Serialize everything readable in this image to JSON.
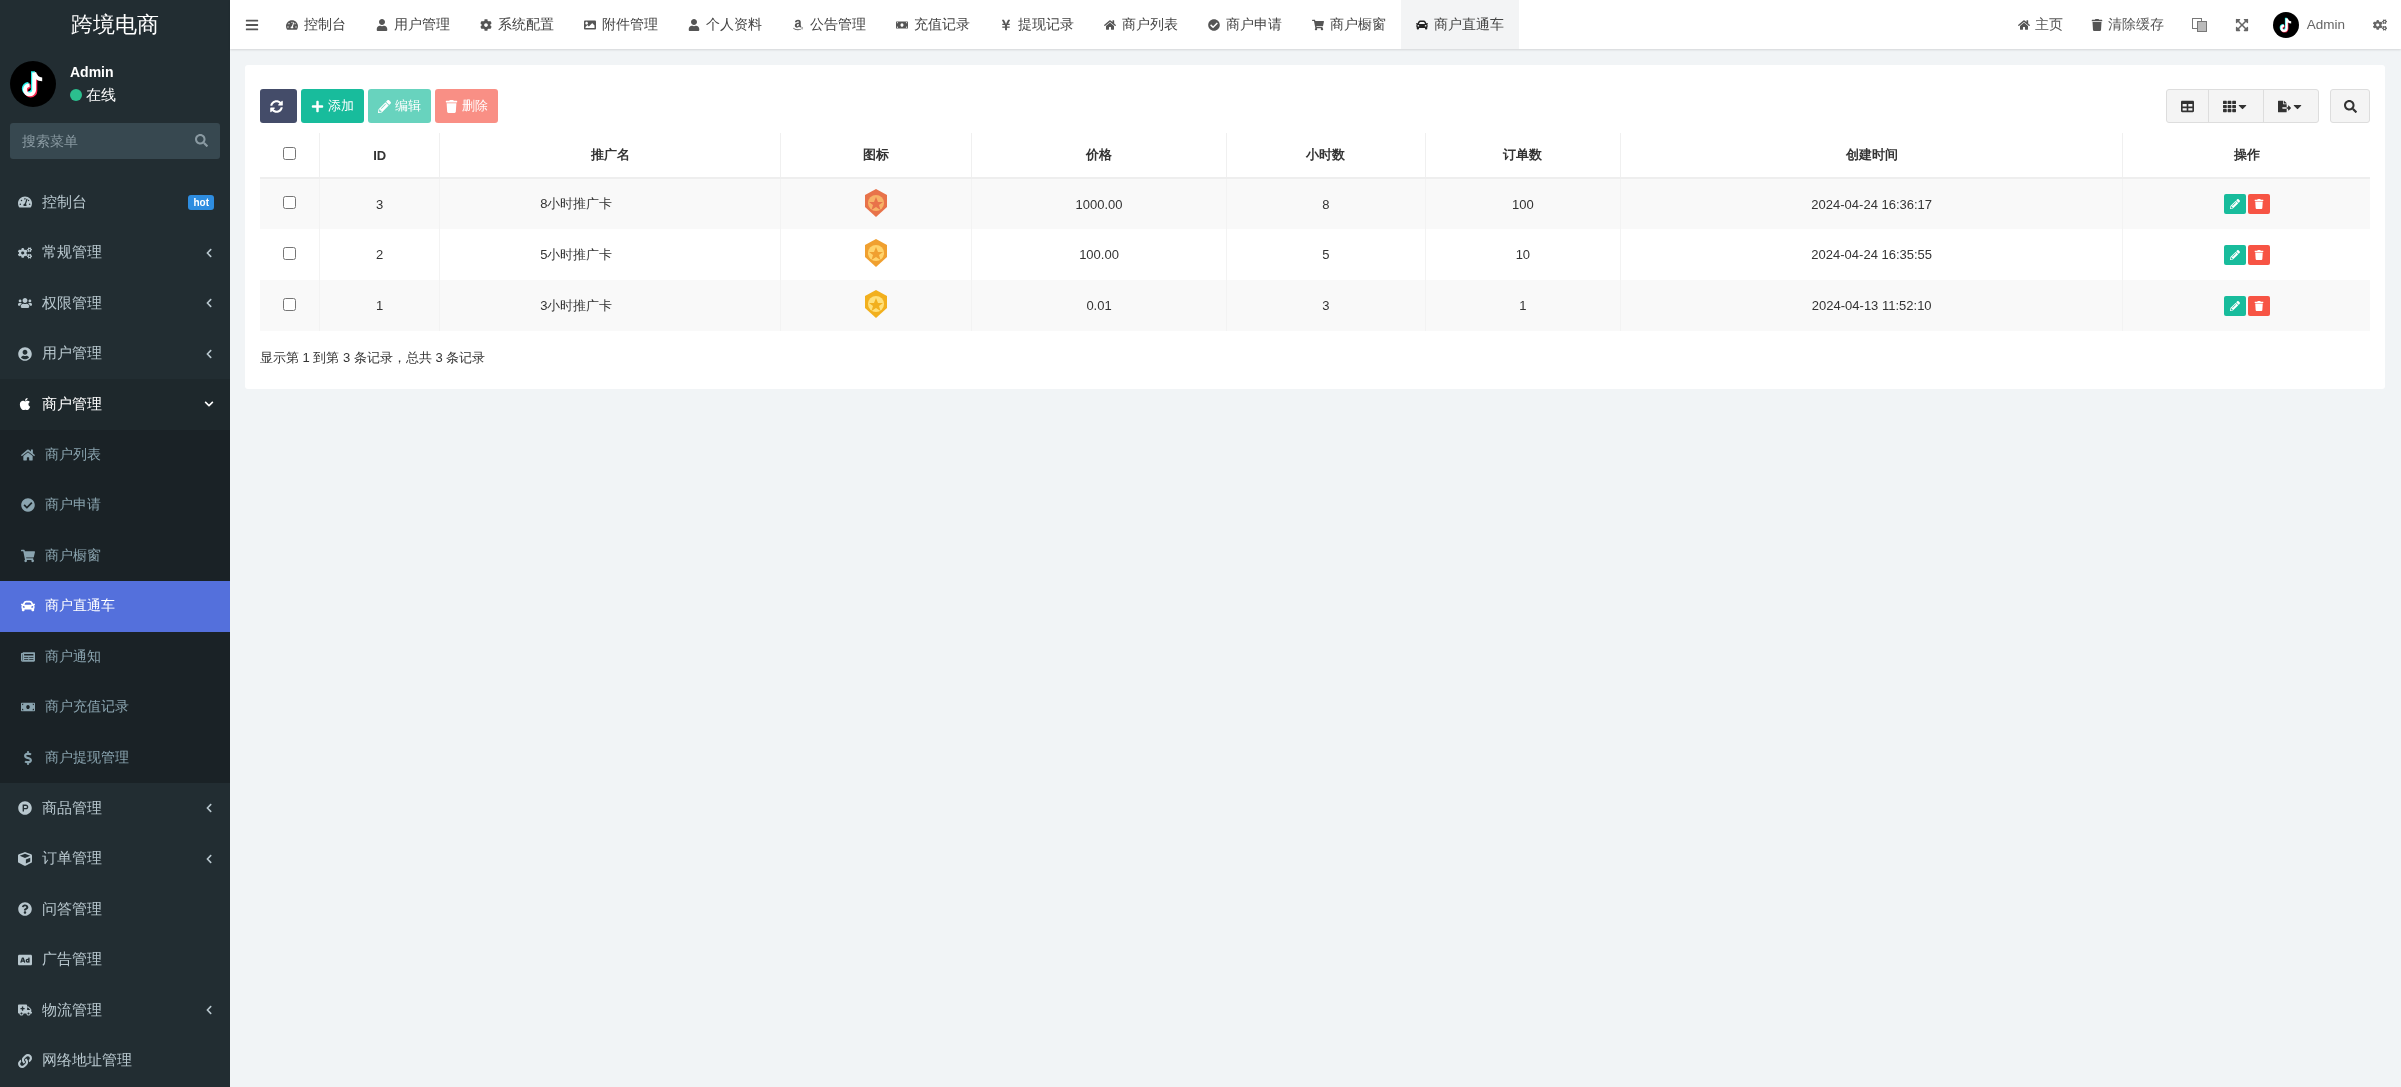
{
  "sidebar": {
    "brand": "跨境电商",
    "user": {
      "name": "Admin",
      "status": "在线",
      "online": true
    },
    "search": {
      "placeholder": "搜索菜单"
    },
    "menu": [
      {
        "label": "控制台",
        "badge": "hot",
        "selected": false
      },
      {
        "label": "常规管理",
        "expanded": false,
        "selected": false
      },
      {
        "label": "权限管理",
        "expanded": false,
        "selected": false
      },
      {
        "label": "用户管理",
        "expanded": false,
        "selected": false
      },
      {
        "label": "商户管理",
        "expanded": true,
        "selected": false,
        "children": [
          {
            "label": "商户列表",
            "selected": false
          },
          {
            "label": "商户申请",
            "selected": false
          },
          {
            "label": "商户橱窗",
            "selected": false
          },
          {
            "label": "商户直通车",
            "selected": true
          },
          {
            "label": "商户通知",
            "selected": false
          },
          {
            "label": "商户充值记录",
            "selected": false
          },
          {
            "label": "商户提现管理",
            "selected": false
          }
        ]
      },
      {
        "label": "商品管理",
        "expanded": false,
        "selected": false
      },
      {
        "label": "订单管理",
        "expanded": false,
        "selected": false
      },
      {
        "label": "问答管理",
        "selected": false
      },
      {
        "label": "广告管理",
        "selected": false
      },
      {
        "label": "物流管理",
        "expanded": false,
        "selected": false
      },
      {
        "label": "网络地址管理",
        "selected": false
      }
    ]
  },
  "topbar": {
    "tabs": [
      {
        "label": "控制台",
        "selected": false
      },
      {
        "label": "用户管理",
        "selected": false
      },
      {
        "label": "系统配置",
        "selected": false
      },
      {
        "label": "附件管理",
        "selected": false
      },
      {
        "label": "个人资料",
        "selected": false
      },
      {
        "label": "公告管理",
        "selected": false
      },
      {
        "label": "充值记录",
        "selected": false
      },
      {
        "label": "提现记录",
        "selected": false
      },
      {
        "label": "商户列表",
        "selected": false
      },
      {
        "label": "商户申请",
        "selected": false
      },
      {
        "label": "商户橱窗",
        "selected": false
      },
      {
        "label": "商户直通车",
        "selected": true
      }
    ],
    "links": [
      "主页",
      "清除缓存"
    ],
    "user": "Admin"
  },
  "toolbar": {
    "buttons": [
      {
        "kind": "refresh",
        "disabled": false
      },
      {
        "kind": "add",
        "label": "添加",
        "disabled": false
      },
      {
        "kind": "edit",
        "label": "编辑",
        "disabled": true
      },
      {
        "kind": "delete",
        "label": "删除",
        "disabled": true
      }
    ]
  },
  "table": {
    "columns": [
      "ID",
      "推广名",
      "图标",
      "价格",
      "小时数",
      "订单数",
      "创建时间",
      "操作"
    ],
    "header_checked": false,
    "rows": [
      {
        "checked": false,
        "id": "3",
        "name": "8小时推广卡",
        "price": "1000.00",
        "hours": "8",
        "orders": "100",
        "created": "2024-04-24 16:36:17"
      },
      {
        "checked": false,
        "id": "2",
        "name": "5小时推广卡",
        "price": "100.00",
        "hours": "5",
        "orders": "10",
        "created": "2024-04-24 16:35:55"
      },
      {
        "checked": false,
        "id": "1",
        "name": "3小时推广卡",
        "price": "0.01",
        "hours": "3",
        "orders": "1",
        "created": "2024-04-13 11:52:10"
      }
    ]
  },
  "pagination": {
    "summary": "显示第 1 到第 3 条记录，总共 3 条记录"
  }
}
